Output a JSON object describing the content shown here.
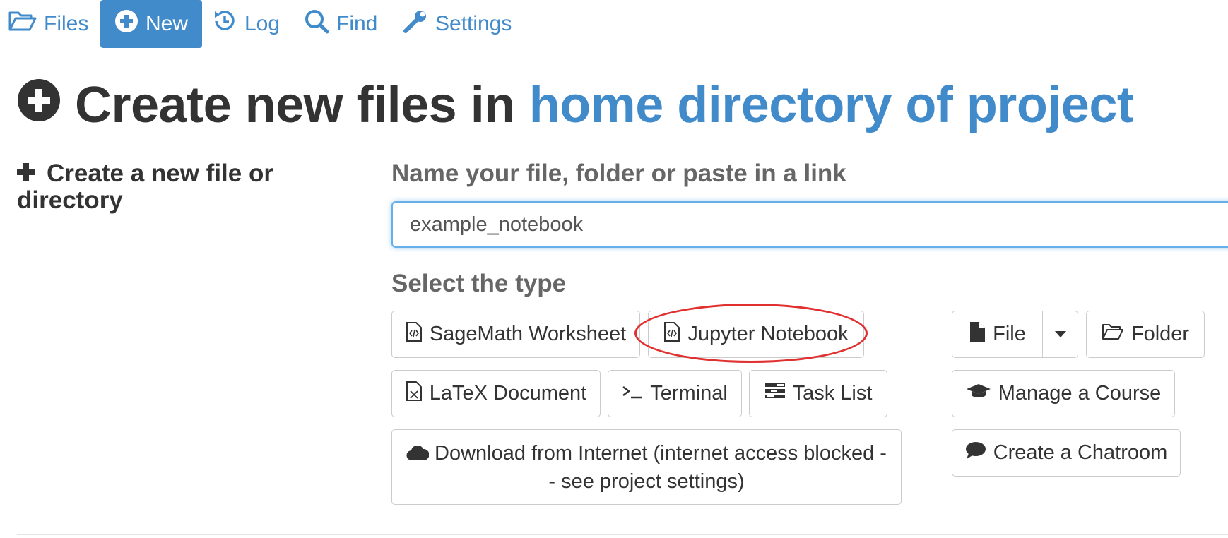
{
  "nav": {
    "files": "Files",
    "new": "New",
    "log": "Log",
    "find": "Find",
    "settings": "Settings"
  },
  "title": {
    "prefix": "Create new files in",
    "directory": "home directory of project"
  },
  "sidebar": {
    "heading": "Create a new file or directory"
  },
  "form": {
    "name_label": "Name your file, folder or paste in a link",
    "name_value": "example_notebook",
    "type_label": "Select the type"
  },
  "buttons": {
    "sagemath": "SageMath Worksheet",
    "jupyter": "Jupyter Notebook",
    "latex": "LaTeX Document",
    "terminal": "Terminal",
    "tasklist": "Task List",
    "download": "Download from Internet (internet access blocked -- see project settings)",
    "file": "File",
    "folder": "Folder",
    "course": "Manage a Course",
    "chatroom": "Create a Chatroom"
  },
  "colors": {
    "accent": "#428bca",
    "highlight": "#e03030"
  }
}
